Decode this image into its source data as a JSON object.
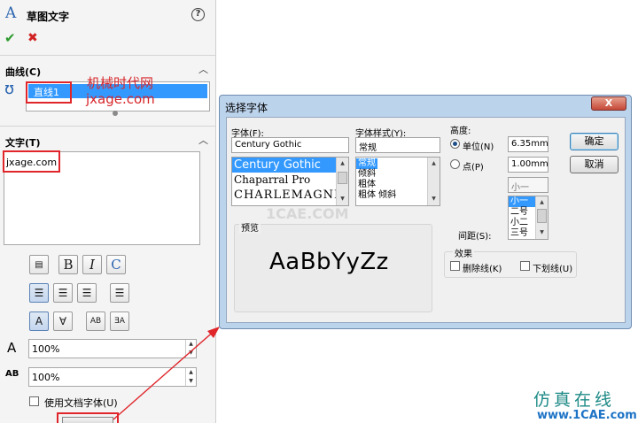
{
  "panel": {
    "title": "草图文字",
    "curve_section": "曲线(C)",
    "curve_item": "直线1",
    "text_section": "文字(T)",
    "text_value": "jxage.com",
    "width_value": "100%",
    "spacing_value": "100%",
    "use_doc_font": "使用文档字体(U)",
    "annotation_cn": "机械时代网",
    "annotation_url": "jxage.com"
  },
  "dialog": {
    "title": "选择字体",
    "close": "X",
    "font_label": "字体(F):",
    "font_value": "Century Gothic",
    "fonts": [
      "Century Gothic",
      "Chaparral Pro",
      "CHARLEMAGNE"
    ],
    "style_label": "字体样式(Y):",
    "style_value": "常规",
    "styles": [
      "常规",
      "倾斜",
      "粗体",
      "粗体 倾斜"
    ],
    "height_label": "高度:",
    "unit_label": "单位(N)",
    "unit_value": "6.35mm",
    "point_label": "点(P)",
    "point_value": "1.00mm",
    "size_value": "小一",
    "sizes": [
      "小一",
      "二号",
      "小二",
      "三号"
    ],
    "spacing_label": "间距(S):",
    "ok": "确定",
    "cancel": "取消",
    "preview_label": "预览",
    "preview_text": "AaBbYyZz",
    "effects_label": "效果",
    "strikeout": "删除线(K)",
    "underline": "下划线(U)"
  },
  "watermark": {
    "cn": "仿真在线",
    "url": "www.1CAE.com",
    "center": "1CAE.COM"
  },
  "colors": {
    "accent_red": "#e0262b",
    "selection": "#3399ff"
  }
}
